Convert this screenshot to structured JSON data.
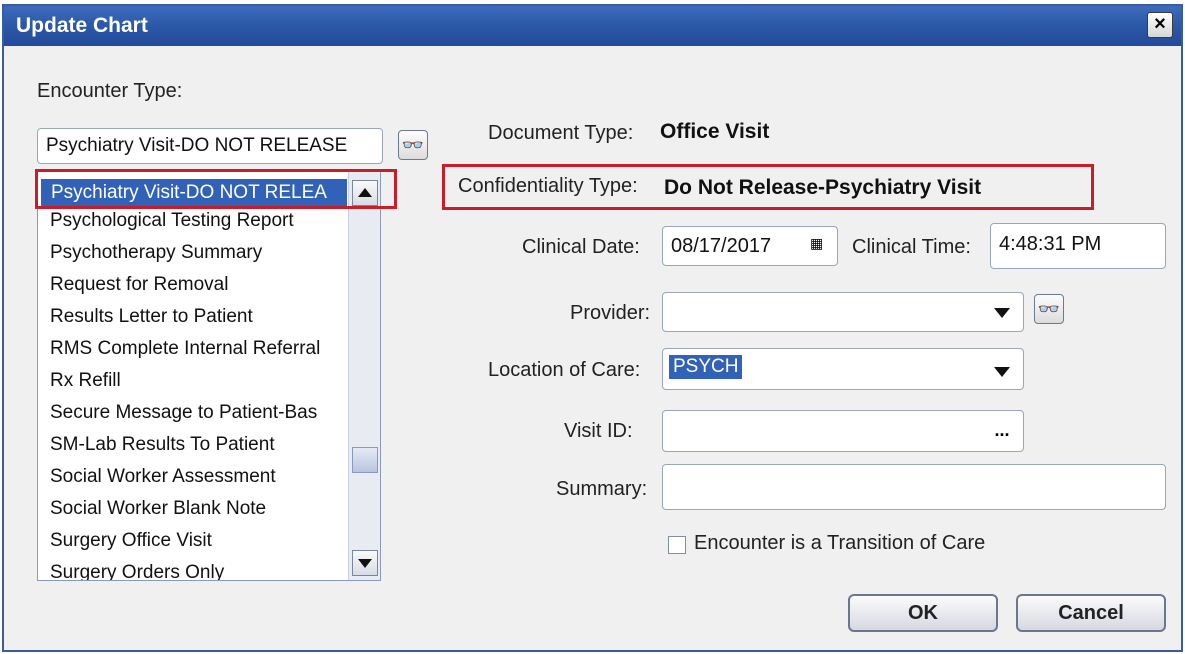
{
  "window": {
    "title": "Update Chart"
  },
  "encounter": {
    "label": "Encounter Type:",
    "value": "Psychiatry Visit-DO NOT RELEASE",
    "list_items": [
      "Psychiatry Visit-DO NOT RELEA",
      "Psychological Testing Report",
      "Psychotherapy Summary",
      "Request for Removal",
      "Results Letter to Patient",
      "RMS Complete Internal Referral",
      "Rx Refill",
      "Secure Message to Patient-Bas",
      "SM-Lab Results To Patient",
      "Social Worker Assessment",
      "Social Worker Blank Note",
      "Surgery Office Visit",
      "Surgery Orders Only"
    ]
  },
  "document_type": {
    "label": "Document Type:",
    "value": "Office Visit"
  },
  "confidentiality": {
    "label": "Confidentiality Type:",
    "value": "Do Not Release-Psychiatry Visit"
  },
  "clinical_date": {
    "label": "Clinical Date:",
    "value": "08/17/2017"
  },
  "clinical_time": {
    "label": "Clinical Time:",
    "value": "4:48:31 PM"
  },
  "provider": {
    "label": "Provider:",
    "value": ""
  },
  "location": {
    "label": "Location of Care:",
    "value": "PSYCH"
  },
  "visit_id": {
    "label": "Visit ID:",
    "value": "",
    "button": "..."
  },
  "summary": {
    "label": "Summary:",
    "value": ""
  },
  "transition": {
    "label": "Encounter is a Transition of Care",
    "checked": false
  },
  "buttons": {
    "ok": "OK",
    "cancel": "Cancel"
  },
  "colors": {
    "title_bar": "#2d5aa8",
    "highlight_box": "#c81e2a",
    "selection": "#3261b8"
  }
}
